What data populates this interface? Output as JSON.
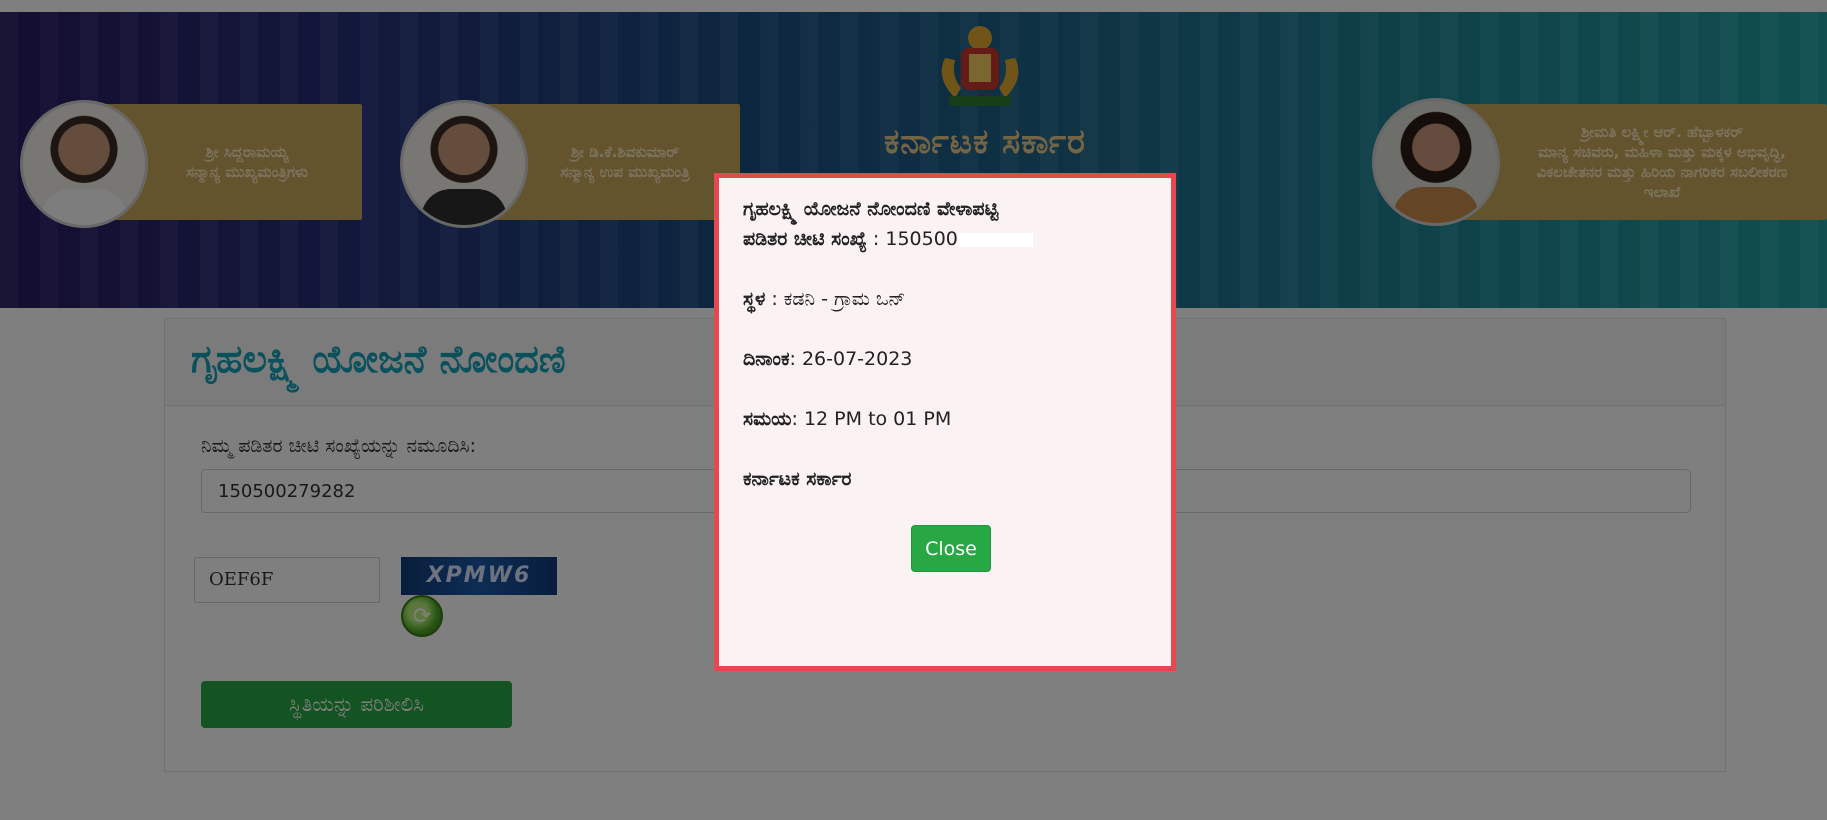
{
  "header": {
    "leaders": [
      {
        "name": "ಶ್ರೀ ಸಿದ್ದರಾಮಯ್ಯ",
        "title": "ಸನ್ಮಾನ್ಯ ಮುಖ್ಯಮಂತ್ರಿಗಳು"
      },
      {
        "name": "ಶ್ರೀ ಡಿ.ಕೆ.ಶಿವಕುಮಾರ್",
        "title": "ಸನ್ಮಾನ್ಯ ಉಪ ಮುಖ್ಯಮಂತ್ರಿ"
      },
      {
        "name": "ಶ್ರೀಮತಿ ಲಕ್ಷ್ಮೀ ಆರ್. ಹೆಬ್ಬಾಳಕರ್",
        "title": "ಮಾನ್ಯ ಸಚಿವರು, ಮಹಿಳಾ ಮತ್ತು ಮಕ್ಕಳ ಅಭಿವೃದ್ಧಿ, ವಿಕಲಚೇತನರ ಮತ್ತು ಹಿರಿಯ ನಾಗರಿಕರ ಸಬಲೀಕರಣ ಇಲಾಖೆ"
      }
    ],
    "state_title": "ಕರ್ನಾಟಕ ಸರ್ಕಾರ"
  },
  "main": {
    "page_title": "ಗೃಹಲಕ್ಷ್ಮಿ ಯೋಜನೆ ನೋಂದಣಿ",
    "page_title_tail": "ು",
    "field_label": "ನಿಮ್ಮ ಪಡಿತರ ಚೀಟಿ ಸಂಖ್ಯೆಯನ್ನು ನಮೂದಿಸಿ:",
    "ration_card_value": "150500279282",
    "captcha_value": "OEF6F",
    "captcha_image_text": "XPMW6",
    "submit_label": "ಸ್ಥಿತಿಯನ್ನು ಪರಿಶೀಲಿಸಿ"
  },
  "modal": {
    "heading": "ಗೃಹಲಕ್ಷ್ಮಿ ಯೋಜನೆ ನೋಂದಣಿ ವೇಳಾಪಟ್ಟಿ",
    "ration_label": "ಪಡಿತರ ಚೀಟಿ ಸಂಖ್ಯೆ",
    "ration_value": " : 150500",
    "place_label": "ಸ್ಥಳ",
    "place_value": " : ಕಡನಿ - ಗ್ರಾಮ ಒನ್",
    "date_label": "ದಿನಾಂಕ",
    "date_value": ": 26-07-2023",
    "time_label": "ಸಮಯ",
    "time_value": ": 12 PM to 01 PM",
    "footer": "ಕರ್ನಾಟಕ ಸರ್ಕಾರ",
    "close_label": "Close"
  },
  "icons": {
    "refresh": "refresh-icon",
    "emblem": "karnataka-emblem-icon"
  },
  "colors": {
    "accent_teal": "#17a2b8",
    "button_green": "#28a745",
    "modal_border": "#e8474f"
  }
}
